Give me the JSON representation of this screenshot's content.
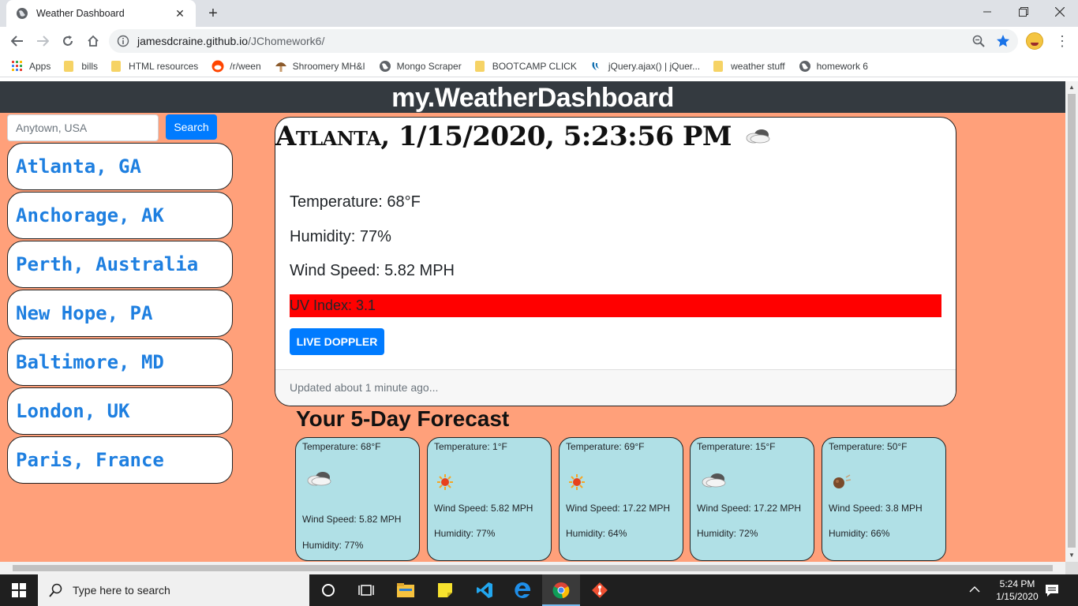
{
  "browser": {
    "tab_title": "Weather Dashboard",
    "url_host": "jamesdcraine.github.io",
    "url_path": "/JChomework6/",
    "bookmarks": [
      "Apps",
      "bills",
      "HTML resources",
      "/r/ween",
      "Shroomery MH&I",
      "Mongo Scraper",
      "BOOTCAMP CLICK",
      "jQuery.ajax() | jQuer...",
      "weather stuff",
      "homework 6"
    ]
  },
  "page": {
    "site_title": "my.WeatherDashboard",
    "search_placeholder": "Anytown, USA",
    "search_button": "Search",
    "cities": [
      "Atlanta, GA",
      "Anchorage, AK",
      "Perth, Australia",
      "New Hope, PA",
      "Baltimore, MD",
      "London, UK",
      "Paris, France"
    ],
    "current": {
      "heading": "Atlanta, 1/15/2020, 5:23:56 PM",
      "icon": "cloud-icon",
      "temperature": "Temperature: 68°F",
      "humidity": "Humidity: 77%",
      "wind": "Wind Speed: 5.82 MPH",
      "uv": "UV Index: 3.1",
      "uv_color": "#ff0000",
      "doppler_button": "LIVE DOPPLER",
      "footer": "Updated about 1 minute ago..."
    },
    "forecast_title": "Your 5-Day Forecast",
    "forecast": [
      {
        "temp": "Temperature: 68°F",
        "icon": "cloud-icon",
        "wind": "Wind Speed: 5.82 MPH",
        "humidity": "Humidity: 77%"
      },
      {
        "temp": "Temperature: 1°F",
        "icon": "sun-icon",
        "wind": "Wind Speed: 5.82 MPH",
        "humidity": "Humidity: 77%"
      },
      {
        "temp": "Temperature: 69°F",
        "icon": "sun-icon",
        "wind": "Wind Speed: 17.22 MPH",
        "humidity": "Humidity: 64%"
      },
      {
        "temp": "Temperature: 15°F",
        "icon": "cloud-icon",
        "wind": "Wind Speed: 17.22 MPH",
        "humidity": "Humidity: 72%"
      },
      {
        "temp": "Temperature: 50°F",
        "icon": "meteor-icon",
        "wind": "Wind Speed: 3.8 MPH",
        "humidity": "Humidity: 66%"
      }
    ],
    "background_color": "#ffa07a",
    "forecast_card_color": "#b0e0e6",
    "accent_color": "#007bff"
  },
  "taskbar": {
    "search_placeholder": "Type here to search",
    "time": "5:24 PM",
    "date": "1/15/2020"
  }
}
